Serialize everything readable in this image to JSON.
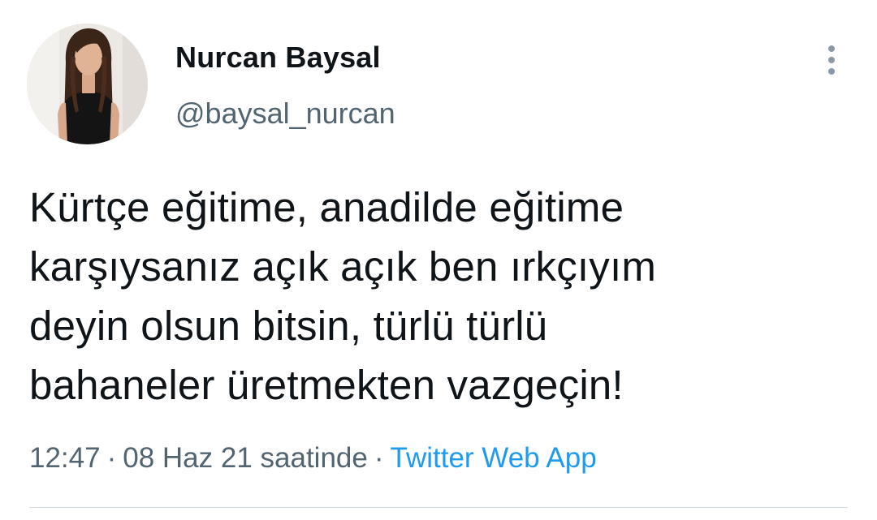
{
  "author": {
    "display_name": "Nurcan Baysal",
    "handle": "@baysal_nurcan",
    "avatar_icon": "profile-photo"
  },
  "tweet": {
    "text_lines": [
      "Kürtçe eğitime, anadilde eğitime",
      "karşıysanız açık açık ben ırkçıyım",
      "deyin olsun bitsin, türlü türlü",
      "bahaneler üretmekten vazgeçin!"
    ],
    "time": "12:47",
    "separator": "·",
    "date": "08 Haz 21 saatinde",
    "source": "Twitter Web App"
  },
  "menu": {
    "icon": "more-vertical-icon"
  },
  "colors": {
    "text": "#0f1419",
    "secondary": "#536471",
    "link": "#1d9bf0",
    "divider": "#cfd9de"
  }
}
